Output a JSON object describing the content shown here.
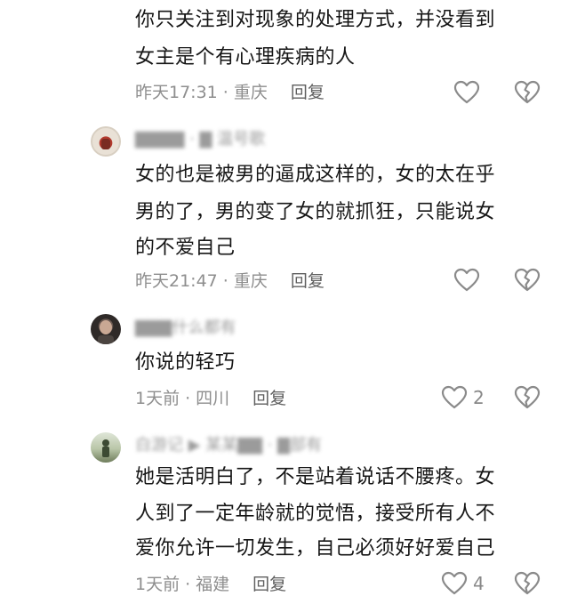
{
  "comments": [
    {
      "lines": [
        "你只关注到对现象的处理方式，并没看到",
        "女主是个有心理疾病的人"
      ],
      "time": "昨天17:31",
      "location": "重庆",
      "reply": "回复",
      "like_count": ""
    },
    {
      "username": "▇▇▇▇ · ▇ 温号歌",
      "lines": [
        "女的也是被男的逼成这样的，女的太在乎",
        "男的了，男的变了女的就抓狂，只能说女",
        "的不爱自己"
      ],
      "time": "昨天21:47",
      "location": "重庆",
      "reply": "回复",
      "like_count": ""
    },
    {
      "username": "▇▇▇什么都有",
      "lines": [
        "你说的轻巧"
      ],
      "time": "1天前",
      "location": "四川",
      "reply": "回复",
      "like_count": "2"
    },
    {
      "username": "白游记 ▶ 某某▇▇ · ▇部有",
      "lines": [
        "她是活明白了，不是站着说话不腰疼。女",
        "人到了一定年龄就的觉悟，接受所有人不",
        "爱你允许一切发生，自己必须好好爱自己"
      ],
      "time": "1天前",
      "location": "福建",
      "reply": "回复",
      "like_count": "4"
    }
  ],
  "colors": {
    "text": "#161616",
    "meta": "#8e8e8e",
    "icon": "#8a8a8a"
  }
}
